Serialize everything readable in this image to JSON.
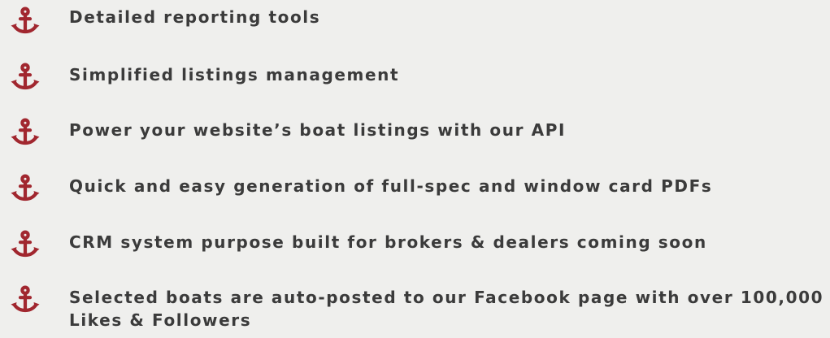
{
  "theme": {
    "background": "#efefed",
    "text_color": "#3b3b3b",
    "accent_color": "#a1272f"
  },
  "features": {
    "icon_name": "anchor-icon",
    "items": [
      {
        "text": "Detailed reporting tools"
      },
      {
        "text": "Simplified listings management"
      },
      {
        "text": "Power your website’s boat listings with our API"
      },
      {
        "text": "Quick and easy generation of full-spec and window card PDFs"
      },
      {
        "text": "CRM system purpose built for brokers & dealers coming soon"
      },
      {
        "text": "Selected boats are auto-posted to our Facebook page with over 100,000 Likes & Followers"
      }
    ]
  }
}
